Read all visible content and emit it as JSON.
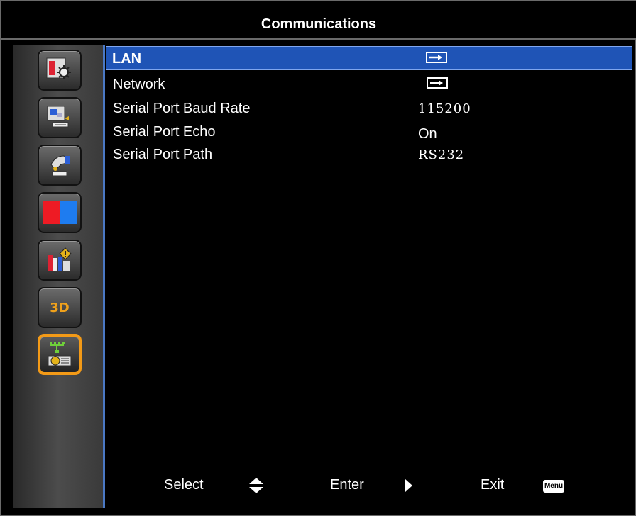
{
  "header": {
    "title": "Communications"
  },
  "sidebar": {
    "items": [
      {
        "icon": "picture-settings-icon"
      },
      {
        "icon": "image-setup-icon"
      },
      {
        "icon": "installation-icon"
      },
      {
        "icon": "color-icon"
      },
      {
        "icon": "information-icon"
      },
      {
        "icon": "3d-icon",
        "label": "3D"
      },
      {
        "icon": "network-communications-icon"
      }
    ],
    "active_index": 6
  },
  "menu": {
    "rows": [
      {
        "label": "LAN",
        "value_type": "enter-arrow"
      },
      {
        "label": "Network",
        "value_type": "enter-arrow"
      },
      {
        "label": "Serial Port Baud Rate",
        "value": "115200"
      },
      {
        "label": "Serial Port Echo",
        "value": "On"
      },
      {
        "label": "Serial Port Path",
        "value": "RS232"
      }
    ],
    "selected_index": 0
  },
  "footer": {
    "select_label": "Select",
    "enter_label": "Enter",
    "exit_label": "Exit",
    "menu_key_label": "Menu"
  },
  "colors": {
    "highlight": "#1f54b6",
    "active_tile_border": "#f39a17",
    "sidebar_edge": "#4a78c4"
  }
}
